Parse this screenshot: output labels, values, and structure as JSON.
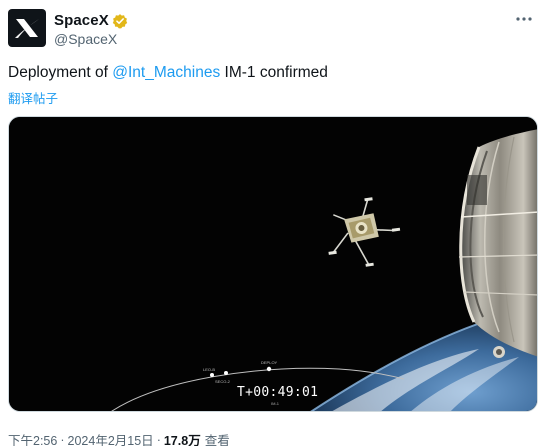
{
  "author": {
    "display_name": "SpaceX",
    "handle": "@SpaceX",
    "avatar_icon": "spacex-logo-icon",
    "verified_icon": "verified-badge-icon",
    "verified_color": "#e2b719"
  },
  "tweet": {
    "text_prefix": "Deployment of",
    "mention": "@Int_Machines",
    "text_suffix": "IM-1 confirmed",
    "translate_label": "翻译帖子",
    "mention_color": "#1d9bf0"
  },
  "media": {
    "timer": "T+00:49:01",
    "timer_sub": "IM-1",
    "stage_labels": [
      "LEO-B",
      "DEPLOY",
      "SECO-2"
    ]
  },
  "footer": {
    "time": "下午2:56",
    "date": "2024年2月15日",
    "separator": "·",
    "views_count": "17.8万",
    "views_label": "查看"
  },
  "menu_icon": "more-horizontal-icon"
}
